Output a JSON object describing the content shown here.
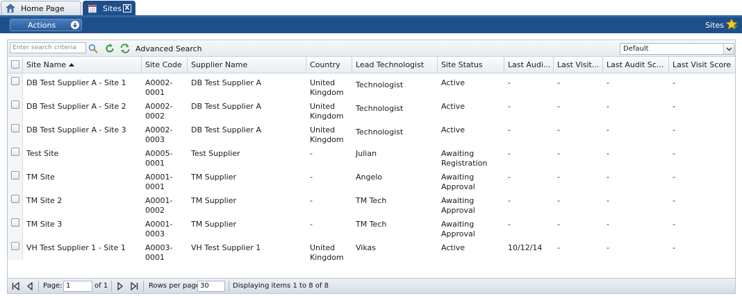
{
  "tabs": [
    {
      "label": "Home Page",
      "icon": "home-icon"
    },
    {
      "label": "Sites",
      "icon": "calendar-icon",
      "close_label": "X"
    }
  ],
  "toolbar": {
    "actions_label": "Actions",
    "title": "Sites",
    "title_icon": "favorite-star-icon",
    "color": "#1f4f8b"
  },
  "search": {
    "placeholder": "Enter search criteria",
    "value": "",
    "advanced_label": "Advanced Search",
    "view_selected": "Default"
  },
  "columns": [
    "Site Name",
    "Site Code",
    "Supplier Name",
    "Country",
    "Lead Technologist",
    "Site Status",
    "Last Audi...",
    "Last Visit...",
    "Last Audit Sc...",
    "Last Visit Score"
  ],
  "sort": {
    "column": "Site Name",
    "direction": "ascending"
  },
  "rows": [
    {
      "site_name": "DB Test Supplier A - Site 1",
      "site_code": "A0002-\n0001",
      "supplier": "DB Test Supplier A",
      "country": "United\nKingdom",
      "lead": "Technologist",
      "status": "Active",
      "last_audit": "-",
      "last_visit": "-",
      "audit_score": "-",
      "visit_score": "-"
    },
    {
      "site_name": "DB Test Supplier A - Site 2",
      "site_code": "A0002-\n0002",
      "supplier": "DB Test Supplier A",
      "country": "United\nKingdom",
      "lead": "Technologist",
      "status": "Active",
      "last_audit": "-",
      "last_visit": "-",
      "audit_score": "-",
      "visit_score": "-"
    },
    {
      "site_name": "DB Test Supplier A - Site 3",
      "site_code": "A0002-\n0003",
      "supplier": "DB Test Supplier A",
      "country": "United\nKingdom",
      "lead": "Technologist",
      "status": "Active",
      "last_audit": "-",
      "last_visit": "-",
      "audit_score": "-",
      "visit_score": "-"
    },
    {
      "site_name": "Test Site",
      "site_code": "A0005-\n0001",
      "supplier": "Test Supplier",
      "country": "-",
      "lead": "Julian",
      "status": "Awaiting\nRegistration",
      "last_audit": "-",
      "last_visit": "-",
      "audit_score": "-",
      "visit_score": "-"
    },
    {
      "site_name": "TM Site",
      "site_code": "A0001-\n0001",
      "supplier": "TM Supplier",
      "country": "-",
      "lead": "Angelo",
      "status": "Awaiting\nApproval",
      "last_audit": "-",
      "last_visit": "-",
      "audit_score": "-",
      "visit_score": "-"
    },
    {
      "site_name": "TM Site 2",
      "site_code": "A0001-\n0002",
      "supplier": "TM Supplier",
      "country": "-",
      "lead": "TM Tech",
      "status": "Awaiting\nApproval",
      "last_audit": "-",
      "last_visit": "-",
      "audit_score": "-",
      "visit_score": "-"
    },
    {
      "site_name": "TM Site 3",
      "site_code": "A0001-\n0003",
      "supplier": "TM Supplier",
      "country": "-",
      "lead": "TM Tech",
      "status": "Awaiting\nApproval",
      "last_audit": "-",
      "last_visit": "-",
      "audit_score": "-",
      "visit_score": "-"
    },
    {
      "site_name": "VH Test Supplier 1 - Site 1",
      "site_code": "A0003-\n0001",
      "supplier": "VH Test Supplier 1",
      "country": "United\nKingdom",
      "lead": "Vikas",
      "status": "Active",
      "last_audit": "10/12/14",
      "last_visit": "-",
      "audit_score": "-",
      "visit_score": "-"
    }
  ],
  "pager": {
    "page_label": "Page:",
    "page_value": "1",
    "of_label": "of 1",
    "rows_label": "Rows per page",
    "rows_value": "30",
    "display_text": "Displaying items 1 to 8 of 8"
  }
}
